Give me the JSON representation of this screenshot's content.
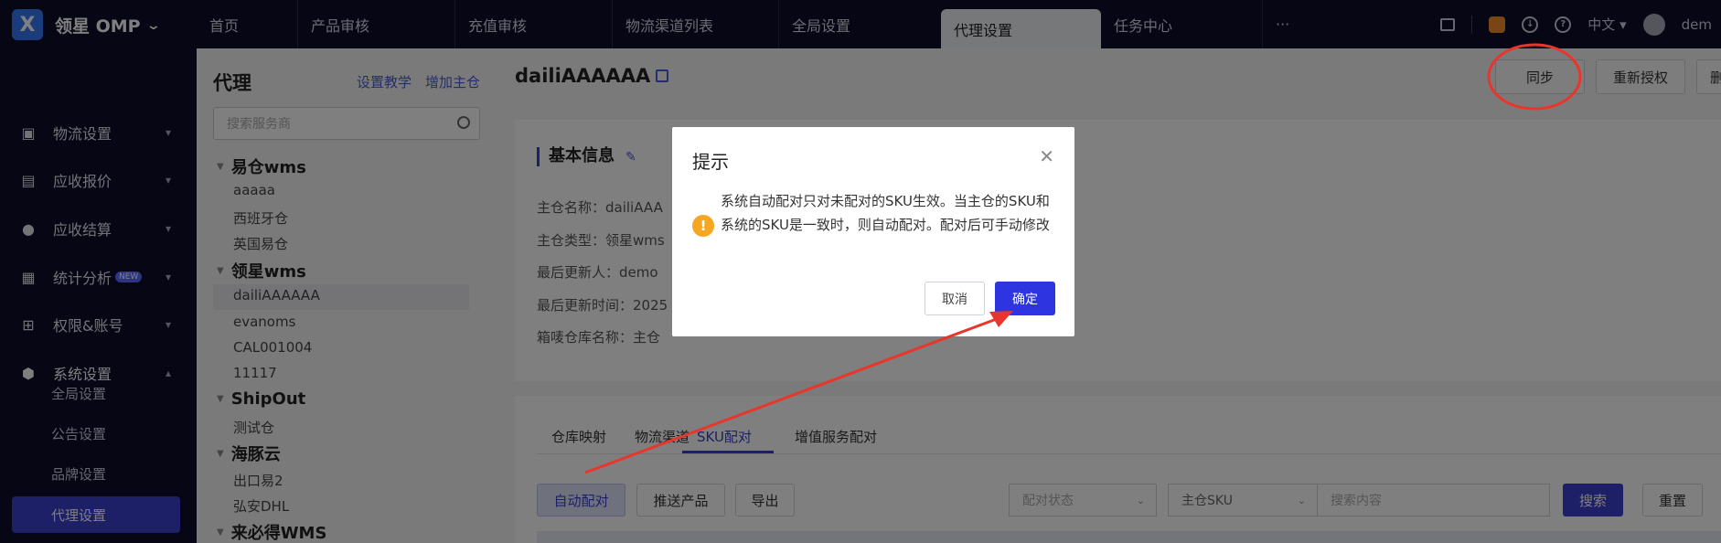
{
  "app": {
    "logo_letter": "X",
    "brand": "领星 OMP"
  },
  "nav_tabs": [
    {
      "label": "首页"
    },
    {
      "label": "产品审核"
    },
    {
      "label": "充值审核"
    },
    {
      "label": "物流渠道列表"
    },
    {
      "label": "全局设置"
    },
    {
      "label": "代理设置"
    },
    {
      "label": "任务中心"
    },
    {
      "label": "···"
    }
  ],
  "topbar": {
    "language": "中文",
    "user": "dem"
  },
  "sidebar": {
    "items": [
      {
        "label": "物流设置"
      },
      {
        "label": "应收报价"
      },
      {
        "label": "应收结算"
      },
      {
        "label": "统计分析",
        "badge": "NEW"
      },
      {
        "label": "权限&账号"
      },
      {
        "label": "系统设置"
      }
    ],
    "sub_items": [
      {
        "label": "全局设置"
      },
      {
        "label": "公告设置"
      },
      {
        "label": "品牌设置"
      },
      {
        "label": "代理设置"
      }
    ]
  },
  "tree": {
    "title": "代理",
    "link_tutorial": "设置教学",
    "link_add": "增加主仓",
    "search_placeholder": "搜索服务商",
    "groups": [
      {
        "name": "易仓wms",
        "items": [
          "aaaaa",
          "西班牙仓",
          "英国易仓"
        ]
      },
      {
        "name": "领星wms",
        "items": [
          "dailiAAAAAA",
          "evanoms",
          "CAL001004",
          "11117"
        ]
      },
      {
        "name": "ShipOut",
        "items": [
          "测试仓"
        ]
      },
      {
        "name": "海豚云",
        "items": [
          "出口易2",
          "弘安DHL"
        ]
      },
      {
        "name": "来必得WMS",
        "items": []
      }
    ]
  },
  "main": {
    "title": "dailiAAAAAA",
    "header_buttons": [
      "同步",
      "重新授权",
      "删除"
    ],
    "card_title": "基本信息",
    "info": [
      "主仓名称：dailiAAA",
      "主仓类型：领星wms",
      "最后更新人：demo",
      "最后更新时间：2025",
      "箱唛仓库名称：主仓"
    ],
    "tabs": [
      "仓库映射",
      "物流渠道",
      "SKU配对",
      "增值服务配对"
    ],
    "actions": [
      "自动配对",
      "推送产品",
      "导出"
    ],
    "filter_status": "配对状态",
    "filter_sku": "主仓SKU",
    "search_placeholder": "搜索内容",
    "search_btn": "搜索",
    "reset_btn": "重置"
  },
  "dialog": {
    "title": "提示",
    "message": "系统自动配对只对未配对的SKU生效。当主仓的SKU和系统的SKU是一致时，则自动配对。配对后可手动修改",
    "cancel": "取消",
    "ok": "确定"
  },
  "colors": {
    "primary": "#3a3fcf",
    "topbar": "#0c0c2b",
    "warning": "#f5a623",
    "annotation": "#e8362c"
  }
}
